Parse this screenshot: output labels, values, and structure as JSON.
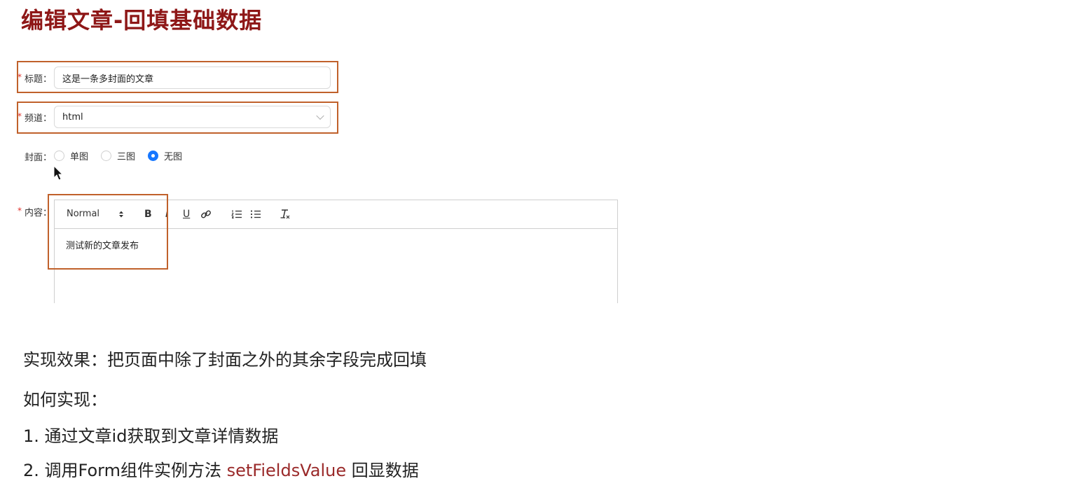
{
  "slide": {
    "title": "编辑文章-回填基础数据"
  },
  "form": {
    "title_field": {
      "label": "标题：",
      "value": "这是一条多封面的文章",
      "required": true
    },
    "channel_field": {
      "label": "频道：",
      "value": "html",
      "required": true
    },
    "cover_field": {
      "label": "封面：",
      "options": [
        "单图",
        "三图",
        "无图"
      ],
      "selected": "无图"
    },
    "content_field": {
      "label": "内容：",
      "required": true,
      "toolbar": {
        "format_select": "Normal",
        "icons": [
          "select-arrows-icon",
          "bold-icon",
          "italic-icon",
          "underline-icon",
          "link-icon",
          "ordered-list-icon",
          "bullet-list-icon",
          "clear-format-icon"
        ],
        "bold_glyph": "B",
        "italic_glyph": "I",
        "underline_glyph": "U"
      },
      "body_text": "测试新的文章发布"
    },
    "required_mark": "*"
  },
  "notes": {
    "effect": "实现效果：把页面中除了封面之外的其余字段完成回填",
    "how_label": "如何实现：",
    "step1": "1. 通过文章id获取到文章详情数据",
    "step2_prefix": "2. 调用Form组件实例方法 ",
    "step2_code": "setFieldsValue",
    "step2_suffix": " 回显数据"
  },
  "colors": {
    "title": "#8e1717",
    "highlight_box": "#c0612b",
    "required": "#e0312a",
    "radio_selected": "#1677ff",
    "code_text": "#9a2a2a"
  }
}
